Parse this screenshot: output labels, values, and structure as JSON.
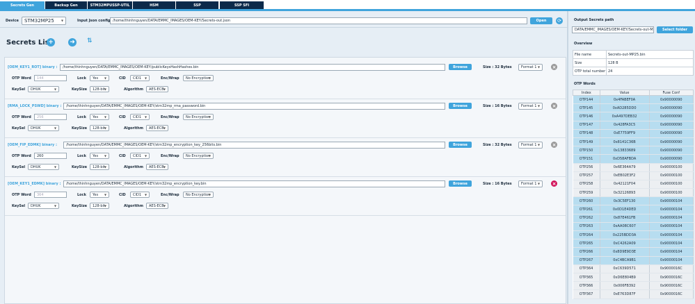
{
  "tabs": [
    {
      "label": "Secrets Gen",
      "active": true
    },
    {
      "label": "Backup Gen",
      "active": false
    },
    {
      "label": "STM32MPUSSP-UTIL",
      "active": false
    },
    {
      "label": "HSM",
      "active": false
    },
    {
      "label": "SSP",
      "active": false
    },
    {
      "label": "SSP SFI",
      "active": false
    }
  ],
  "topbar": {
    "device_label": "Device",
    "device_value": "STM32MP25",
    "input_json_label": "Input Json config",
    "input_json_value": "/home/thinhnguyen/DATA/EMMC_IMAGES/OEM-KEY/Secrets-out.json",
    "open_button": "Open"
  },
  "secrets": {
    "title": "Secrets List"
  },
  "labels": {
    "browse": "Browse",
    "otp_word": "OTP Word",
    "lock": "Lock",
    "cid": "CID",
    "enc_wrap": "Enc/Wrap",
    "keysel": "KeySel",
    "keysize": "KeySize",
    "algorithm": "Algorithm"
  },
  "entries": [
    {
      "title": "[OEM_KEY1_ROT] binary :",
      "path": "/home/thinhnguyen/DATA/EMMC_IMAGES/OEM-KEY/publicKeysHashHashes.bin",
      "size": "Size : 32 Bytes",
      "format": "Format 1",
      "otp_word": "144",
      "otp_enabled": false,
      "lock": "Yes",
      "cid": "CID1",
      "enc": "No Encryption",
      "keysel": "DHUK",
      "keysize": "128-bit",
      "algorithm": "AES-ECB",
      "close_color": "gray"
    },
    {
      "title": "[RMA_LOCK_PSWD] binary :",
      "path": "/home/thinhnguyen/DATA/EMMC_IMAGES/OEM-KEY/stm32mp_rma_password.bin",
      "size": "Size : 16 Bytes",
      "format": "Format 1",
      "otp_word": "256",
      "otp_enabled": false,
      "lock": "Yes",
      "cid": "CID1",
      "enc": "No Encryption",
      "keysel": "DHUK",
      "keysize": "128-bit",
      "algorithm": "AES-ECB",
      "close_color": "gray"
    },
    {
      "title": "[OEM_FIP_EDMK] binary :",
      "path": "/home/thinhnguyen/DATA/EMMC_IMAGES/OEM-KEY/stm32mp_encryption_key_256bits.bin",
      "size": "Size : 32 Bytes",
      "format": "Format 1",
      "otp_word": "260",
      "otp_enabled": true,
      "lock": "Yes",
      "cid": "CID1",
      "enc": "No Encryption",
      "keysel": "DHUK",
      "keysize": "128-bit",
      "algorithm": "AES-ECB",
      "close_color": "gray"
    },
    {
      "title": "[OEM_KEY1_EDMK] binary :",
      "path": "/home/thinhnguyen/DATA/EMMC_IMAGES/OEM-KEY/stm32mp_encryption_key.bin",
      "size": "Size : 16 Bytes",
      "format": "Format 1",
      "otp_word": "364",
      "otp_enabled": false,
      "lock": "Yes",
      "cid": "CID1",
      "enc": "No Encryption",
      "keysel": "DHUK",
      "keysize": "128-bit",
      "algorithm": "AES-ECB",
      "close_color": "red"
    }
  ],
  "right": {
    "output_title": "Output Secrets path",
    "output_path": "DATA/EMMC_IMAGES/OEM-KEY/Secrets-out-MP25.bin",
    "select_folder": "Select folder",
    "overview_title": "Overview",
    "overview": [
      {
        "key": "File name",
        "value": "Secrets-out-MP25.bin"
      },
      {
        "key": "Size",
        "value": "128 B"
      },
      {
        "key": "OTP total number",
        "value": "24"
      }
    ],
    "otp_words_title": "OTP Words",
    "otp_headers": [
      "Index",
      "Value",
      "Fuse Conf"
    ],
    "otp_rows": [
      {
        "index": "OTP144",
        "value": "0x4FABEF0A",
        "fuse": "0x90000090",
        "style": "hl"
      },
      {
        "index": "OTP145",
        "value": "0xAD285DD0",
        "fuse": "0x90000090",
        "style": "hl"
      },
      {
        "index": "OTP146",
        "value": "0xA497DEB32",
        "fuse": "0x90000090",
        "style": "hl"
      },
      {
        "index": "OTP147",
        "value": "0x428FA3C5",
        "fuse": "0x90000090",
        "style": "hl"
      },
      {
        "index": "OTP148",
        "value": "0xE7759FF9",
        "fuse": "0x90000090",
        "style": "hl"
      },
      {
        "index": "OTP149",
        "value": "0x8141C36B",
        "fuse": "0x90000090",
        "style": "hl"
      },
      {
        "index": "OTP150",
        "value": "0x13833689",
        "fuse": "0x90000090",
        "style": "hl"
      },
      {
        "index": "OTP151",
        "value": "0xD58AFBDA",
        "fuse": "0x90000090",
        "style": "hl"
      },
      {
        "index": "OTP256",
        "value": "0x6E364A79",
        "fuse": "0x90000100",
        "style": "gr"
      },
      {
        "index": "OTP257",
        "value": "0xEB02E3F2",
        "fuse": "0x90000100",
        "style": "gr"
      },
      {
        "index": "OTP258",
        "value": "0x42121F04",
        "fuse": "0x90000100",
        "style": "gr"
      },
      {
        "index": "OTP259",
        "value": "0x32126893",
        "fuse": "0x90000100",
        "style": "gr"
      },
      {
        "index": "OTP260",
        "value": "0x3C5EF130",
        "fuse": "0x90000104",
        "style": "hl"
      },
      {
        "index": "OTP261",
        "value": "0x0D1E4DED",
        "fuse": "0x90000104",
        "style": "hl"
      },
      {
        "index": "OTP262",
        "value": "0x87E461FB",
        "fuse": "0x90000104",
        "style": "hl"
      },
      {
        "index": "OTP263",
        "value": "0xAA08C607",
        "fuse": "0x90000104",
        "style": "hl"
      },
      {
        "index": "OTP264",
        "value": "0x225BDD3A",
        "fuse": "0x90000104",
        "style": "hl"
      },
      {
        "index": "OTP265",
        "value": "0xC4262A09",
        "fuse": "0x90000104",
        "style": "hl"
      },
      {
        "index": "OTP266",
        "value": "0x8D9E9D3E",
        "fuse": "0x90000104",
        "style": "hl"
      },
      {
        "index": "OTP267",
        "value": "0xC4BCA9B1",
        "fuse": "0x90000104",
        "style": "hl"
      },
      {
        "index": "OTP364",
        "value": "0xC639D571",
        "fuse": "0x9000016C",
        "style": "gr"
      },
      {
        "index": "OTP365",
        "value": "0xD6E804B9",
        "fuse": "0x9000016C",
        "style": "gr"
      },
      {
        "index": "OTP366",
        "value": "0x006FB392",
        "fuse": "0x9000016C",
        "style": "gr"
      },
      {
        "index": "OTP367",
        "value": "0xE763D87F",
        "fuse": "0x9000016C",
        "style": "gr"
      }
    ]
  }
}
